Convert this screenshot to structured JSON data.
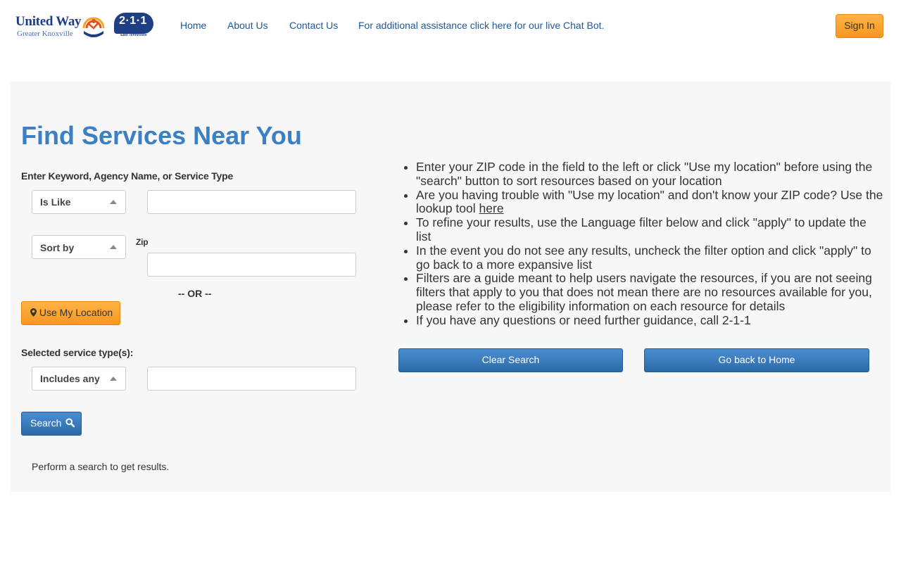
{
  "header": {
    "logo_uw": {
      "line1": "United Way",
      "line2": "Greater Knoxville"
    },
    "logo_211": {
      "number": "2·1·1",
      "region": "East Tennessee"
    },
    "nav": {
      "home": "Home",
      "about": "About Us",
      "contact": "Contact Us",
      "chatbot": "For additional assistance click here for our live Chat Bot."
    },
    "sign_in": "Sign In"
  },
  "main": {
    "title": "Find Services Near You",
    "keyword_label": "Enter Keyword, Agency Name, or Service Type",
    "match_select": "Is Like",
    "keyword_value": "",
    "sort_select": "Sort by",
    "zip_label": "Zip",
    "zip_value": "",
    "or_text": "-- OR --",
    "use_location": "Use My Location",
    "service_type_label": "Selected service type(s):",
    "service_select": "Includes any",
    "service_value": "",
    "search_button": "Search",
    "results_note": "Perform a search to get results."
  },
  "info": {
    "items": [
      "Enter your ZIP code in the field to the left or click \"Use my location\" before using the \"search\" button to sort resources based on your location",
      "Are you having trouble with \"Use my location\" and don't know your ZIP code? Use the lookup tool",
      "To refine your results, use the Language filter below and click \"apply\" to update the list",
      "In the event you do not see any results, uncheck the filter option and click \"apply\" to go back to a more expansive list",
      "Filters are a guide meant to help users navigate the resources, if you are not seeing filters that apply to you that does not mean there are no resources available for you, please refer to the eligibility information on each resource for details",
      "If you have any questions or need further guidance, call 2-1-1"
    ],
    "lookup_link": "here",
    "clear_search": "Clear Search",
    "go_home": "Go back to Home"
  },
  "colors": {
    "title": "#3b7fc4",
    "nav_link": "#1d5896",
    "orange_button": "#f7971e",
    "blue_button": "#2c6aa8",
    "panel_bg": "#f7f7f7"
  },
  "icons": {
    "location": "map-marker-icon",
    "search": "magnifier-icon",
    "dropdown": "caret-up-icon"
  }
}
